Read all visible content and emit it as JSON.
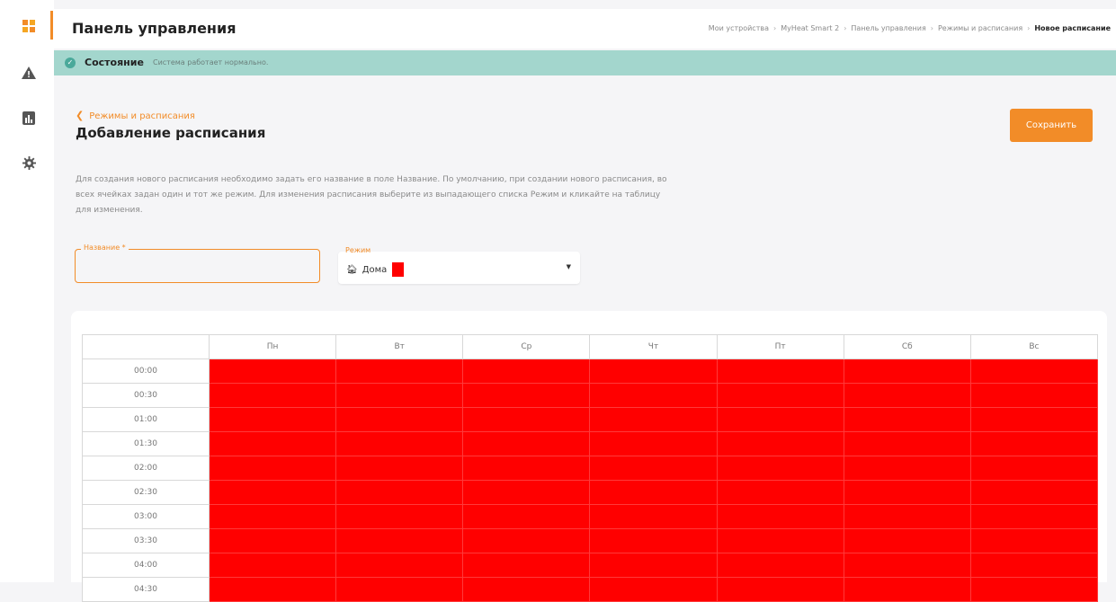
{
  "header": {
    "title": "Панель управления",
    "breadcrumb": [
      "Мои устройства",
      "MyHeat Smart 2",
      "Панель управления",
      "Режимы и расписания"
    ],
    "breadcrumb_current": "Новое расписание"
  },
  "status": {
    "title": "Состояние",
    "text": "Система работает нормально."
  },
  "form": {
    "back_link": "Режимы и расписания",
    "title": "Добавление расписания",
    "save_label": "Сохранить",
    "description": "Для создания нового расписания необходимо задать его название в поле Название. По умолчанию, при создании нового расписания, во всех ячейках задан один и тот же режим. Для изменения расписания выберите из выпадающего списка Режим и кликайте на таблицу для изменения.",
    "name_label": "Название *",
    "name_value": "",
    "mode_label": "Режим",
    "mode_value": "Дома",
    "mode_color": "#ff0000"
  },
  "schedule": {
    "days": [
      "Пн",
      "Вт",
      "Ср",
      "Чт",
      "Пт",
      "Сб",
      "Вс"
    ],
    "times": [
      "00:00",
      "00:30",
      "01:00",
      "01:30",
      "02:00",
      "02:30",
      "03:00",
      "03:30",
      "04:00",
      "04:30"
    ],
    "cell_color": "#ff0000"
  },
  "sidebar": {
    "icons": [
      "dashboard-icon",
      "warning-icon",
      "chart-icon",
      "gear-icon"
    ]
  },
  "colors": {
    "accent": "#f28c28",
    "status_bg": "#a3d6cd"
  }
}
